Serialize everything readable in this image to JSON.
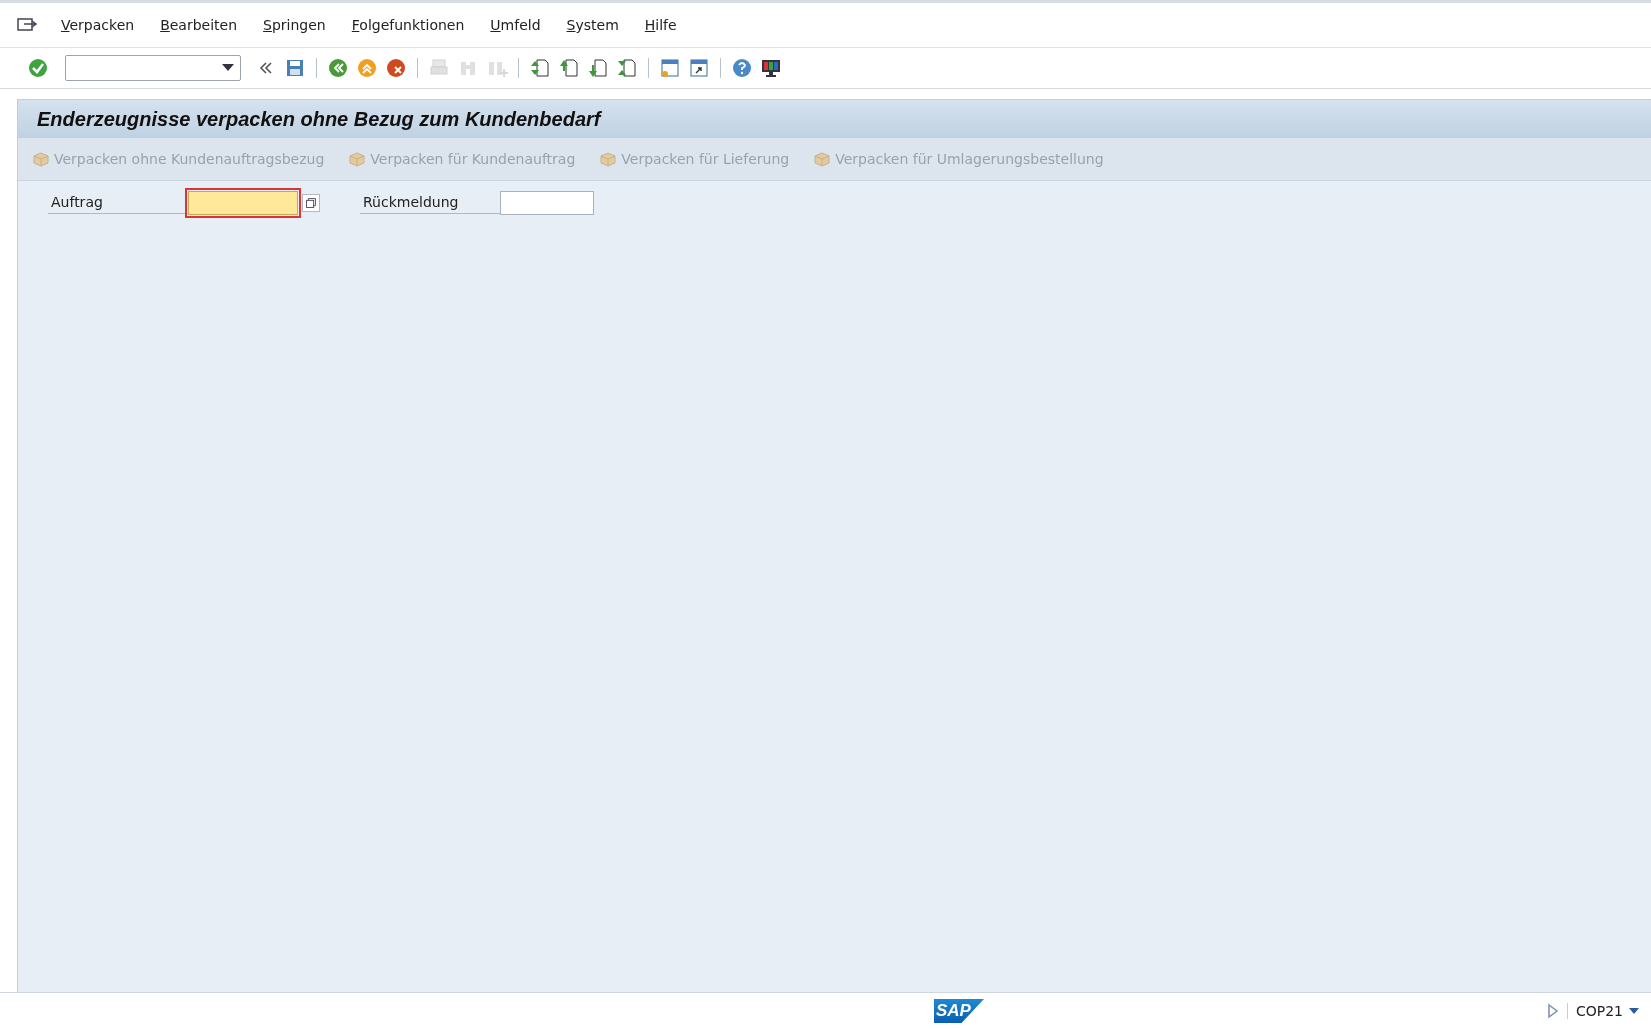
{
  "menu_bar": {
    "items": [
      "Verpacken",
      "Bearbeiten",
      "Springen",
      "Folgefunktionen",
      "Umfeld",
      "System",
      "Hilfe"
    ]
  },
  "screen": {
    "title": "Enderzeugnisse verpacken ohne Bezug zum Kundenbedarf"
  },
  "app_toolbar": [
    {
      "label": "Verpacken ohne Kundenauftragsbezug",
      "disabled": true
    },
    {
      "label": "Verpacken für Kundenauftrag",
      "disabled": true
    },
    {
      "label": "Verpacken für Lieferung",
      "disabled": true
    },
    {
      "label": "Verpacken für Umlagerungsbestellung",
      "disabled": true
    }
  ],
  "fields": [
    {
      "label": "Auftrag",
      "focused": true,
      "value_help": true
    },
    {
      "label": "Rückmeldung",
      "focused": false,
      "value_help": false
    }
  ],
  "status_bar": {
    "logo": "SAP",
    "transaction": "COP21"
  }
}
